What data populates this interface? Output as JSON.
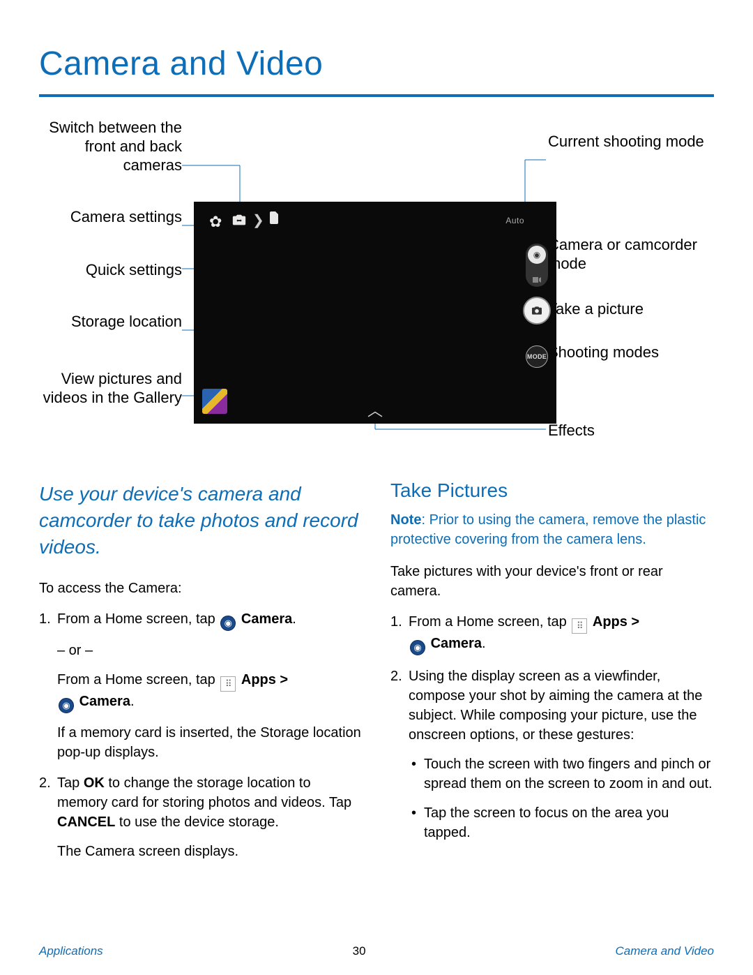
{
  "page_title": "Camera and Video",
  "diagram": {
    "left": {
      "switch_cameras": "Switch between the front and back cameras",
      "camera_settings": "Camera settings",
      "quick_settings": "Quick settings",
      "storage_location": "Storage location",
      "view_gallery": "View pictures and videos in the Gallery"
    },
    "right": {
      "current_mode": "Current shooting mode",
      "cam_or_camcorder": "Camera or camcorder mode",
      "take_picture": "Take a picture",
      "shooting_modes": "Shooting modes",
      "effects": "Effects"
    },
    "auto_label": "Auto",
    "mode_label": "MODE"
  },
  "intro": "Use your device's camera and camcorder to take photos and record videos.",
  "access_heading": "To access the Camera:",
  "steps_left": {
    "s1a": "From a Home screen, tap ",
    "s1a_camera": "Camera",
    "or": "– or –",
    "s1b": "From a Home screen, tap ",
    "s1b_apps": "Apps > ",
    "s1b_camera": "Camera",
    "s1c": "If a memory card is inserted, the Storage location pop-up displays.",
    "s2a": "Tap ",
    "s2a_ok": "OK",
    "s2b": " to change the storage location to memory card for storing photos and videos. Tap ",
    "s2b_cancel": "CANCEL",
    "s2c": " to use the device storage.",
    "s2d": "The Camera screen displays."
  },
  "take_pictures_heading": "Take Pictures",
  "note_label": "Note",
  "note_text": ": Prior to using the camera, remove the plastic protective covering from the camera lens.",
  "take_body": "Take pictures with your device's front or rear camera.",
  "steps_right": {
    "s1a": "From a Home screen, tap ",
    "s1a_apps": "Apps > ",
    "s1a_camera": "Camera",
    "s2": "Using the display screen as a viewfinder, compose your shot by aiming the camera at the subject. While composing your picture, use the onscreen options, or these gestures:",
    "b1": "Touch the screen with two fingers and pinch or spread them on the screen to zoom in and out.",
    "b2": "Tap the screen to focus on the area you tapped."
  },
  "footer": {
    "left": "Applications",
    "center": "30",
    "right": "Camera and Video"
  }
}
